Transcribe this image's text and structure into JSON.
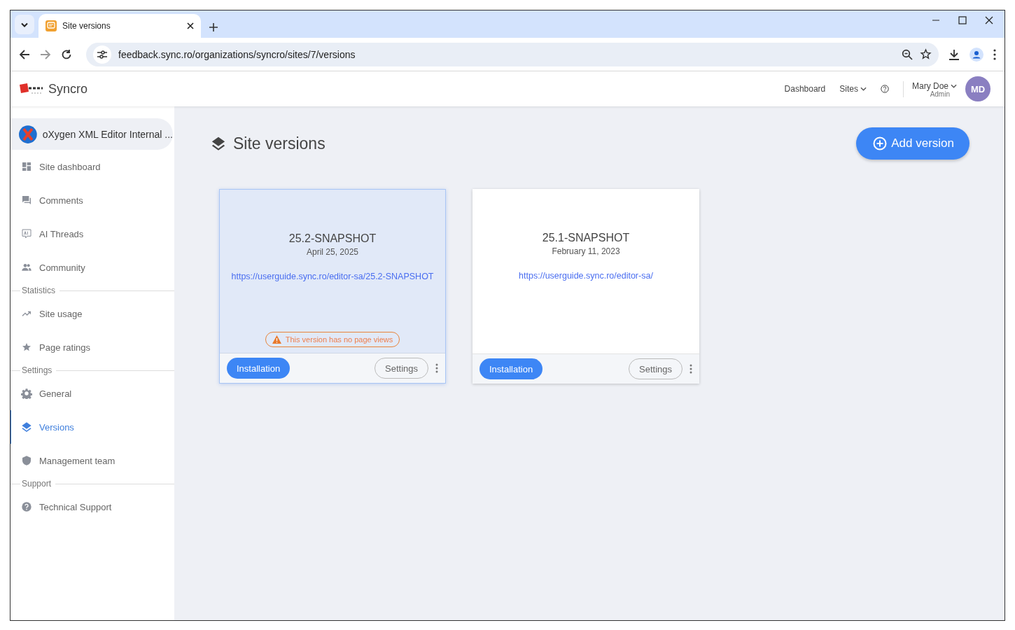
{
  "browser": {
    "tab_title": "Site versions",
    "url": "feedback.sync.ro/organizations/syncro/sites/7/versions"
  },
  "header": {
    "brand": "Syncro",
    "nav": [
      {
        "label": "Dashboard",
        "dropdown": false
      },
      {
        "label": "Sites",
        "dropdown": true
      }
    ],
    "user": {
      "name": "Mary Doe",
      "role": "Admin",
      "initials": "MD"
    }
  },
  "sidebar": {
    "site": "oXygen XML Editor Internal ...",
    "items": [
      {
        "kind": "item",
        "label": "Site dashboard",
        "selected": false
      },
      {
        "kind": "item",
        "label": "Comments",
        "selected": false
      },
      {
        "kind": "item",
        "label": "AI Threads",
        "selected": false
      },
      {
        "kind": "item",
        "label": "Community",
        "selected": false
      },
      {
        "kind": "section",
        "label": "Statistics"
      },
      {
        "kind": "item",
        "label": "Site usage",
        "selected": false
      },
      {
        "kind": "item",
        "label": "Page ratings",
        "selected": false
      },
      {
        "kind": "section",
        "label": "Settings"
      },
      {
        "kind": "item",
        "label": "General",
        "selected": false
      },
      {
        "kind": "item",
        "label": "Versions",
        "selected": true
      },
      {
        "kind": "item",
        "label": "Management team",
        "selected": false
      },
      {
        "kind": "section",
        "label": "Support"
      },
      {
        "kind": "item",
        "label": "Technical Support",
        "selected": false
      }
    ]
  },
  "page": {
    "title": "Site versions",
    "add_button": "Add version",
    "cards": [
      {
        "name": "25.2-SNAPSHOT",
        "date": "April 25, 2025",
        "url": "https://userguide.sync.ro/editor-sa/25.2-SNAPSHOT",
        "selected": true,
        "warning": "This version has no page views",
        "primary": "Installation",
        "secondary": "Settings"
      },
      {
        "name": "25.1-SNAPSHOT",
        "date": "February 11, 2023",
        "url": "https://userguide.sync.ro/editor-sa/",
        "selected": false,
        "primary": "Installation",
        "secondary": "Settings"
      }
    ]
  }
}
